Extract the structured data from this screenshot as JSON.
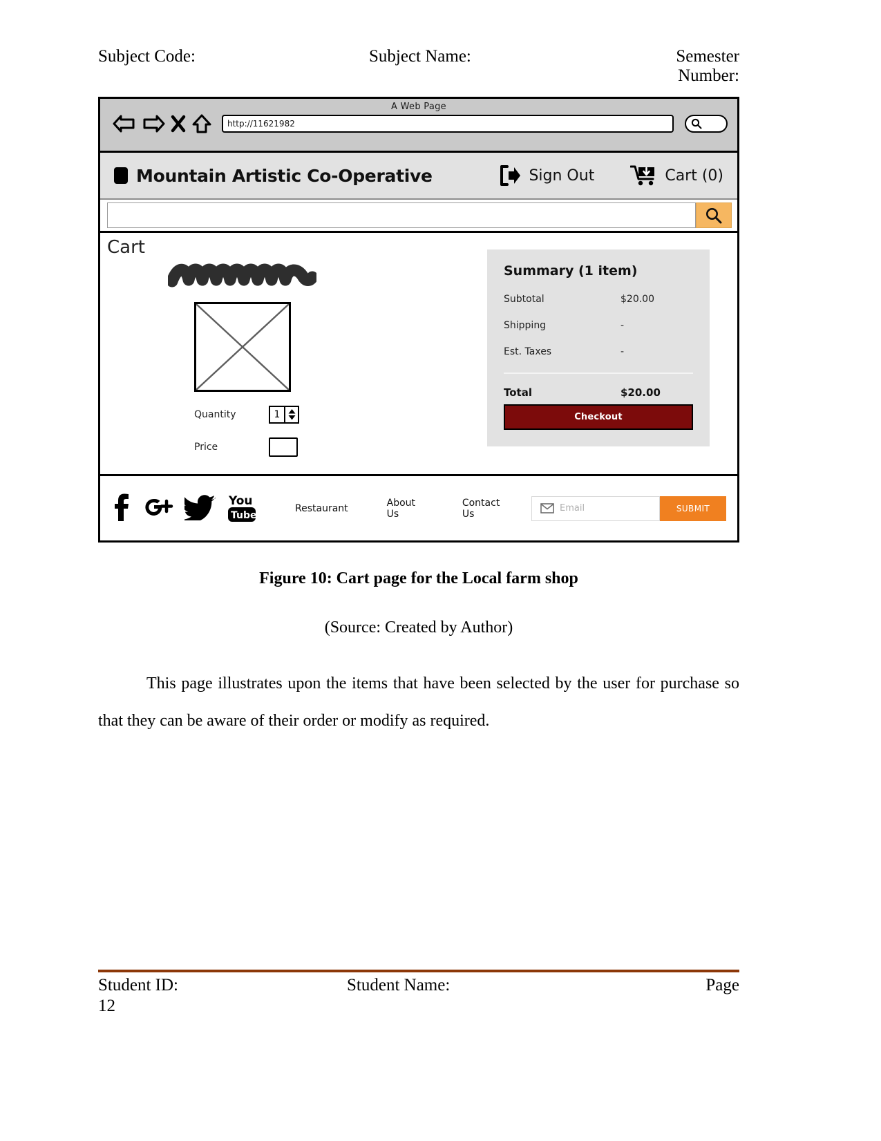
{
  "doc_header": {
    "subject_code": "Subject Code:",
    "subject_name": "Subject Name:",
    "semester_number": "Semester Number:"
  },
  "browser": {
    "window_title": "A Web Page",
    "url": "http://11621982",
    "nav_icons": [
      "back-arrow-icon",
      "forward-arrow-icon",
      "close-x-icon",
      "home-icon"
    ],
    "search_pill_icon": "magnifier-icon"
  },
  "site_header": {
    "logo_icon": "square-logo-icon",
    "brand": "Mountain Artistic Co-Operative",
    "sign_out_icon": "sign-out-icon",
    "sign_out_label": "Sign Out",
    "cart_icon": "shopping-cart-icon",
    "cart_label": "Cart (0)"
  },
  "search_bar": {
    "value": "",
    "placeholder": "",
    "button_icon": "search-icon",
    "button_color": "#f6b761"
  },
  "cart": {
    "title": "Cart",
    "item": {
      "name_placeholder": "scribble-placeholder",
      "image_placeholder": "image-placeholder-x",
      "quantity_label": "Quantity",
      "quantity_value": "1",
      "price_label": "Price",
      "price_value": ""
    }
  },
  "summary": {
    "title": "Summary (1 item)",
    "rows": [
      {
        "label": "Subtotal",
        "value": "$20.00"
      },
      {
        "label": "Shipping",
        "value": "-"
      },
      {
        "label": "Est. Taxes",
        "value": "-"
      }
    ],
    "total_label": "Total",
    "total_value": "$20.00",
    "checkout_label": "Checkout",
    "checkout_color": "#7c0b0b",
    "panel_color": "#e2e2e2"
  },
  "site_footer": {
    "social": [
      {
        "icon": "facebook-icon",
        "name": "Facebook"
      },
      {
        "icon": "google-plus-icon",
        "name": "G+"
      },
      {
        "icon": "twitter-icon",
        "name": "Twitter"
      },
      {
        "icon": "youtube-icon",
        "name": "YouTube"
      }
    ],
    "links": [
      "Restaurant",
      "About Us",
      "Contact Us"
    ],
    "newsletter": {
      "icon": "envelope-icon",
      "placeholder": "Email",
      "value": "",
      "submit_label": "SUBMIT",
      "submit_color": "#f08020"
    }
  },
  "figure": {
    "caption": "Figure 10: Cart page for the Local farm shop",
    "source": "(Source: Created by Author)"
  },
  "body_text": "This page illustrates upon the items that have been selected by the user for purchase so that they can be aware of their order or modify as required.",
  "page_footer": {
    "student_id_label": "Student ID:",
    "student_name_label": "Student Name:",
    "page_label": "Page",
    "page_number": "12",
    "rule_color": "#8c3708"
  }
}
